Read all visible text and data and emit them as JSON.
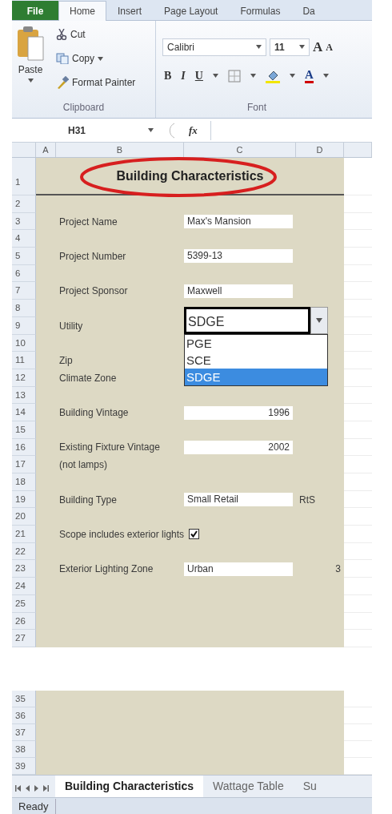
{
  "ribbon": {
    "tabs": [
      {
        "label": "File",
        "kind": "file",
        "selected": false
      },
      {
        "label": "Home",
        "kind": "tab",
        "selected": true
      },
      {
        "label": "Insert",
        "kind": "tab",
        "selected": false
      },
      {
        "label": "Page Layout",
        "kind": "tab",
        "selected": false
      },
      {
        "label": "Formulas",
        "kind": "tab",
        "selected": false
      },
      {
        "label": "Da",
        "kind": "tab",
        "selected": false
      }
    ],
    "clipboard": {
      "paste": "Paste",
      "cut": "Cut",
      "copy": "Copy",
      "format_painter": "Format Painter",
      "group_label": "Clipboard"
    },
    "font": {
      "name": "Calibri",
      "size": "11",
      "grow": "A",
      "shrink": "A",
      "bold": "B",
      "italic": "I",
      "underline": "U",
      "font_color": "A",
      "group_label": "Font"
    }
  },
  "formula_bar": {
    "name_box": "H31",
    "fx": "fx"
  },
  "columns": [
    "A",
    "B",
    "C",
    "D"
  ],
  "rows": [
    {
      "number": "1",
      "kind": "title",
      "text": "Building Characteristics"
    },
    {
      "number": "2",
      "kind": "blank"
    },
    {
      "number": "3",
      "kind": "field",
      "label": "Project Name",
      "value": "Max's Mansion"
    },
    {
      "number": "4",
      "kind": "blank"
    },
    {
      "number": "5",
      "kind": "field",
      "label": "Project Number",
      "value": "5399-13"
    },
    {
      "number": "6",
      "kind": "blank"
    },
    {
      "number": "7",
      "kind": "field",
      "label": "Project Sponsor",
      "value": "Maxwell"
    },
    {
      "number": "8",
      "kind": "blank"
    },
    {
      "number": "9",
      "kind": "dropdown",
      "label": "Utility",
      "value": "SDGE",
      "expanded": true,
      "options": [
        {
          "label": "PGE",
          "selected": false
        },
        {
          "label": "SCE",
          "selected": false
        },
        {
          "label": "SDGE",
          "selected": true
        }
      ]
    },
    {
      "number": "10",
      "kind": "blank"
    },
    {
      "number": "11",
      "kind": "label",
      "label": "Zip"
    },
    {
      "number": "12",
      "kind": "label",
      "label": "Climate Zone"
    },
    {
      "number": "13",
      "kind": "blank"
    },
    {
      "number": "14",
      "kind": "number_field",
      "label": "Building Vintage",
      "value": "1996"
    },
    {
      "number": "15",
      "kind": "blank"
    },
    {
      "number": "16",
      "kind": "number_field",
      "label": "Existing Fixture Vintage",
      "value": "2002"
    },
    {
      "number": "17",
      "kind": "label",
      "label": "(not lamps)"
    },
    {
      "number": "18",
      "kind": "blank"
    },
    {
      "number": "19",
      "kind": "field",
      "label": "Building Type",
      "value": "Small Retail",
      "column_d": {
        "text": "RtS",
        "kind": "text"
      }
    },
    {
      "number": "20",
      "kind": "blank"
    },
    {
      "number": "21",
      "kind": "check",
      "label": "Scope includes exterior lights",
      "checked": true
    },
    {
      "number": "22",
      "kind": "blank"
    },
    {
      "number": "23",
      "kind": "field",
      "label": "Exterior Lighting Zone",
      "value": "Urban",
      "column_d": {
        "text": "3",
        "kind": "number"
      }
    },
    {
      "number": "24",
      "kind": "blank"
    },
    {
      "number": "25",
      "kind": "blank"
    },
    {
      "number": "26",
      "kind": "blank"
    },
    {
      "number": "27",
      "kind": "blank"
    }
  ],
  "rows_lower": [
    {
      "number": "35"
    },
    {
      "number": "36"
    },
    {
      "number": "37"
    },
    {
      "number": "38"
    },
    {
      "number": "39"
    }
  ],
  "sheet_tabs": [
    {
      "label": "Building Characteristics",
      "selected": true
    },
    {
      "label": "Wattage Table",
      "selected": false
    },
    {
      "label": "Su",
      "selected": false
    }
  ],
  "status_bar": {
    "text": "Ready"
  }
}
